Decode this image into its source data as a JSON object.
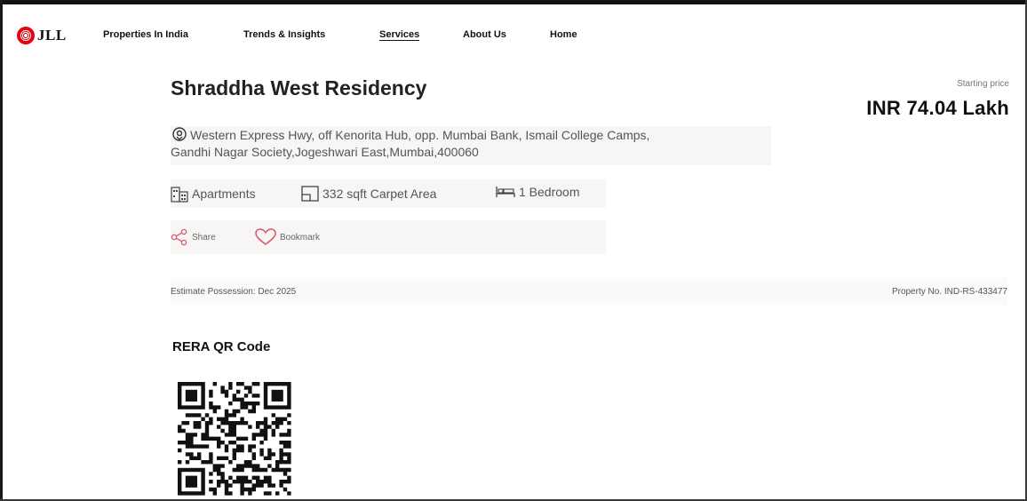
{
  "header": {
    "logo_text": "JLL",
    "nav": [
      {
        "label": "Properties In India",
        "active": false
      },
      {
        "label": "Trends & Insights",
        "active": false
      },
      {
        "label": "Services",
        "active": true
      },
      {
        "label": "About Us",
        "active": false
      },
      {
        "label": "Home",
        "active": false
      }
    ]
  },
  "property": {
    "title": "Shraddha West Residency",
    "price_label": "Starting price",
    "price": "INR 74.04 Lakh",
    "address_line1": "Western Express Hwy, off Kenorita Hub, opp. Mumbai Bank, Ismail College Camps,",
    "address_line2": "Gandhi Nagar Society,Jogeshwari East,Mumbai,400060",
    "features": [
      {
        "icon": "apartment-icon",
        "label": "Apartments"
      },
      {
        "icon": "area-icon",
        "label": "332 sqft Carpet Area"
      },
      {
        "icon": "bed-icon",
        "label": "1 Bedroom"
      }
    ],
    "actions": {
      "share": "Share",
      "bookmark": "Bookmark"
    },
    "possession": "Estimate Possession: Dec 2025",
    "property_no": "Property No. IND-RS-433477",
    "rera_title": "RERA QR Code"
  },
  "colors": {
    "brand_red": "#e30613",
    "action_pink": "#d9566a",
    "text_dark": "#111111",
    "text_muted": "#555555"
  }
}
